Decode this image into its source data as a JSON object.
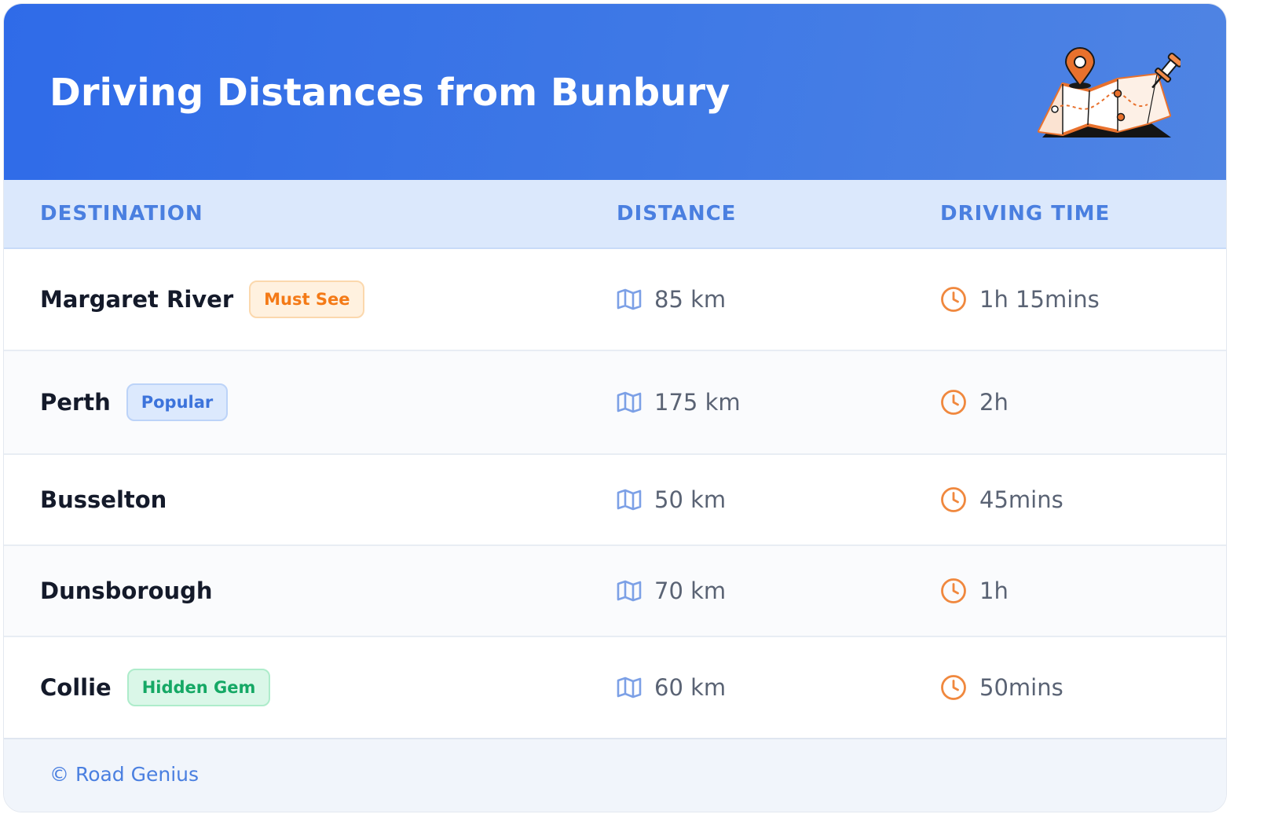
{
  "header": {
    "title": "Driving Distances from Bunbury",
    "illustration": "map-with-pins-illustration",
    "gradient_colors": [
      "#2f6be8",
      "#4f84e3"
    ]
  },
  "table": {
    "columns": [
      "DESTINATION",
      "DISTANCE",
      "DRIVING TIME"
    ],
    "rows": [
      {
        "destination": "Margaret River",
        "badge": "Must See",
        "badge_color": "orange",
        "distance": "85 km",
        "time": "1h 15mins"
      },
      {
        "destination": "Perth",
        "badge": "Popular",
        "badge_color": "blue",
        "distance": "175 km",
        "time": "2h"
      },
      {
        "destination": "Busselton",
        "distance": "50 km",
        "time": "45mins"
      },
      {
        "destination": "Dunsborough",
        "distance": "70 km",
        "time": "1h"
      },
      {
        "destination": "Collie",
        "badge": "Hidden Gem",
        "badge_color": "green",
        "distance": "60 km",
        "time": "50mins"
      }
    ],
    "distance_icon": "map-icon",
    "time_icon": "clock-icon"
  },
  "footer": {
    "text": "© Road Genius"
  },
  "colors": {
    "accent_blue": "#4a7fe0",
    "header_row_bg": "#dbe8fc",
    "clock_orange": "#f0883e",
    "map_icon_blue": "#7ca0e6",
    "badge_orange": "#f47a17",
    "badge_blue": "#3c73db",
    "badge_green": "#15a865"
  }
}
